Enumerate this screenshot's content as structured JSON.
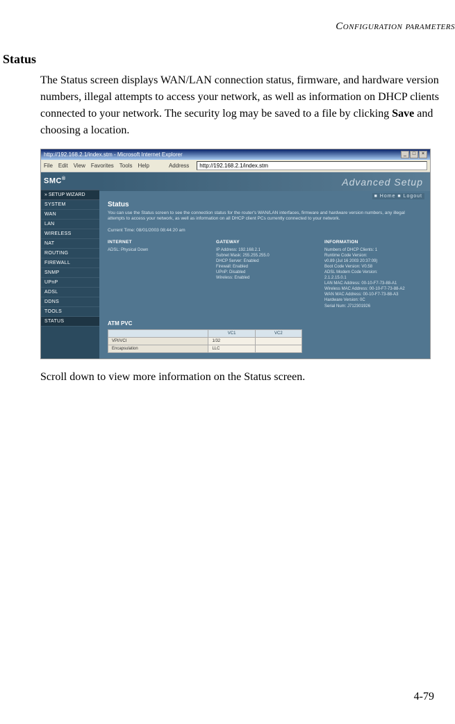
{
  "header": "Configuration parameters",
  "section_title": "Status",
  "paragraph1_parts": {
    "pre": "The Status screen displays WAN/LAN connection status, firmware, and hardware version numbers, illegal attempts to access your network, as well as information on DHCP clients connected to your network. The security log may be saved to a file by clicking ",
    "bold": "Save",
    "post": " and choosing a location."
  },
  "paragraph2": "Scroll down to view more information on the Status screen.",
  "page_number": "4-79",
  "screenshot": {
    "titlebar": "http://192.168.2.1/index.stm - Microsoft Internet Explorer",
    "menus": [
      "File",
      "Edit",
      "View",
      "Favorites",
      "Tools",
      "Help"
    ],
    "address_label": "Address",
    "address": "http://192.168.2.1/index.stm",
    "logo": "SMC",
    "setup_wizard": "» SETUP WIZARD",
    "nav": [
      "SYSTEM",
      "WAN",
      "LAN",
      "WIRELESS",
      "NAT",
      "ROUTING",
      "FIREWALL",
      "SNMP",
      "UPnP",
      "ADSL",
      "DDNS",
      "TOOLS",
      "STATUS"
    ],
    "banner": "Advanced Setup",
    "banner_links": "■ Home  ■ Logout",
    "status_heading": "Status",
    "status_desc": "You can use the Status screen to see the connection status for the router's WAN/LAN interfaces, firmware and hardware version numbers, any illegal attempts to access your network, as well as information on all DHCP client PCs currently connected to your network.",
    "current_time": "Current Time: 08/01/2003 08:44:20 am",
    "cols": {
      "internet": {
        "h": "INTERNET",
        "lines": [
          "ADSL:   Physical Down"
        ]
      },
      "gateway": {
        "h": "GATEWAY",
        "lines": [
          "IP Address:   192.168.2.1",
          "Subnet Mask:   255.255.255.0",
          "DHCP Server:   Enabled",
          "Firewall:   Enabled",
          "UPnP:   Disabled",
          "Wireless:   Enabled"
        ]
      },
      "information": {
        "h": "INFORMATION",
        "lines": [
          "Numbers of DHCP Clients:  1",
          "Runtime Code Version:",
          "  v0.89 (Jul 16 2003 20:37:09)",
          "Boot Code Version:   V0.58",
          "ADSL Modem Code Version:",
          "2.1.2.15.0.1",
          "LAN MAC Address: 00-10-F7-73-88-A1",
          "Wireless MAC Address: 00-10-F7-73-88-A2",
          "WAN MAC Address: 00-10-F7-73-88-A3",
          "Hardware Version:   0C",
          "Serial Num:   J712301926"
        ]
      }
    },
    "atm_heading": "ATM PVC",
    "table": {
      "headers": [
        "",
        "VC1",
        "VC2"
      ],
      "rows": [
        [
          "VPI/VCI",
          "1/32",
          ""
        ],
        [
          "Encapsulation",
          "LLC",
          ""
        ]
      ]
    }
  }
}
